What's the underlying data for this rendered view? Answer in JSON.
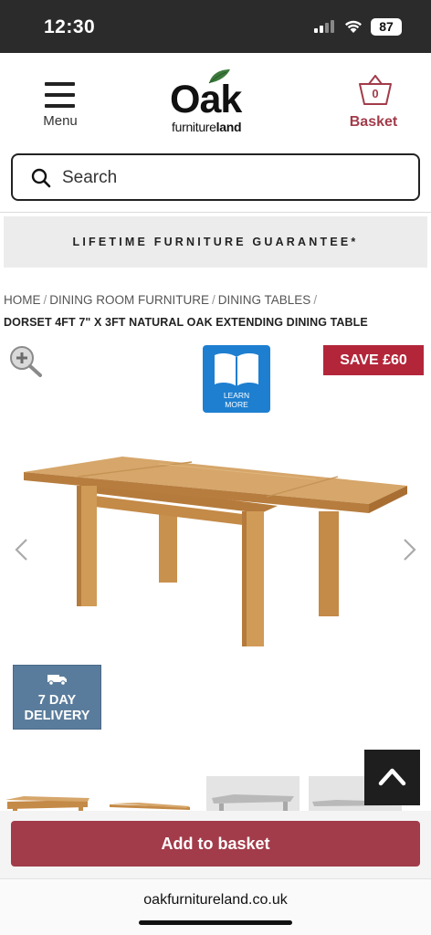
{
  "status_bar": {
    "time": "12:30",
    "battery": "87"
  },
  "header": {
    "menu_label": "Menu",
    "logo": {
      "main": "Oak",
      "sub_a": "furniture",
      "sub_b": "land"
    },
    "basket_label": "Basket",
    "basket_count": "0"
  },
  "search": {
    "placeholder": "Search"
  },
  "banner": {
    "text": "LIFETIME FURNITURE GUARANTEE*"
  },
  "breadcrumb": {
    "items": [
      "HOME",
      "DINING ROOM FURNITURE",
      "DINING TABLES"
    ],
    "separator": "/"
  },
  "product": {
    "title": "DORSET 4FT 7\" X 3FT NATURAL OAK EXTENDING DINING TABLE",
    "save_badge": "SAVE £60",
    "learn_more": {
      "line1": "LEARN",
      "line2": "MORE"
    },
    "delivery_badge": {
      "line1": "7 DAY",
      "line2": "DELIVERY"
    }
  },
  "actions": {
    "add_to_basket": "Add to basket"
  },
  "browser": {
    "url": "oakfurnitureland.co.uk"
  },
  "colors": {
    "accent": "#a23b4a",
    "save_red": "#b3263a",
    "learn_blue": "#1e7fd0",
    "delivery_blue": "#5a7c9c"
  }
}
